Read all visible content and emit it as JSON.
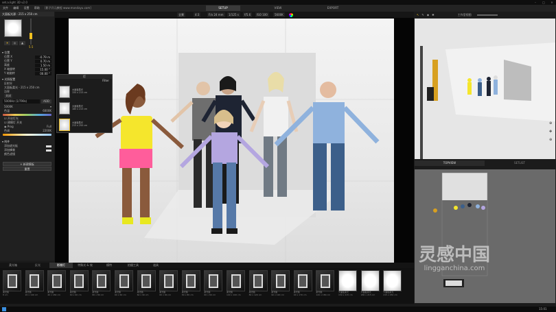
{
  "titlebar": {
    "title": "set.a.light 3D v2.0"
  },
  "menubar": {
    "items": [
      "文件",
      "编辑",
      "设置",
      "帮助"
    ],
    "website": "[影子开元教程 www.mondayu.com]"
  },
  "mode_tabs": [
    {
      "label": "SETUP"
    },
    {
      "label": "VIEW"
    },
    {
      "label": "EXPORT"
    }
  ],
  "left": {
    "header": "大面板光源 - 215 x 250 cm",
    "power_value": "5.5",
    "position_section": "位置",
    "fields": [
      {
        "label": "位置 X",
        "value": "-0.79 m"
      },
      {
        "label": "位置 Y",
        "value": "0.70 m"
      },
      {
        "label": "高度",
        "value": "1.50 m"
      },
      {
        "label": "X 轴旋转",
        "value": "15.00 °"
      },
      {
        "label": "Y 轴旋转",
        "value": "00.00 °"
      }
    ],
    "light_section": "光照配置",
    "modifier_label": "反射伞",
    "modifier_value": "大面板柔光 - 215 x 250 cm",
    "power_label": "功率",
    "mode_label": "关闭",
    "kelvin_value": "5000Hz (1/799s)",
    "add_label": "ADD",
    "kelvin_select": "5000K",
    "kelvin_left": "色温",
    "kelvin_right": "6000K",
    "check_a": "开启灯光",
    "check_b": "建模灯 开关",
    "opt_a": "Prog",
    "opt_b": "Full",
    "hue_left": "色调",
    "hue_right": "2200K",
    "effect_section": "附件",
    "effect_a": "添加遮光板",
    "effect_b": "添加蜂巢",
    "effect_c": "颜色滤镜",
    "apply_button": "+ 新建模板",
    "reset_button": "重置"
  },
  "viewport": {
    "toolbar": [
      "全景",
      "4:3",
      "F/o 24 mm",
      "1/125 s",
      "f/5.6",
      "ISO 100",
      "5600K"
    ],
    "popup": {
      "title": "灯",
      "filter": "Filter",
      "items": [
        {
          "name": "大面板柔光",
          "size": "150 x 215 cm"
        },
        {
          "name": "大面板柔光",
          "size": "180 x 215 cm"
        },
        {
          "name": "大面板柔光",
          "size": "215 x 250 cm"
        }
      ]
    }
  },
  "right": {
    "label": "工作室视图",
    "topview_tab": "TOPVIEW",
    "setlist_tab": "SETLIST"
  },
  "bottom_tabs": [
    "柔光箱",
    "反光",
    "影棚灯",
    "特殊光 & 效",
    "模特",
    "拍摄工具",
    "道具"
  ],
  "library": [
    {
      "name": "柔光箱",
      "size": "8 cm"
    },
    {
      "name": "柔光箱",
      "size": "20 x 140 cm"
    },
    {
      "name": "柔光箱",
      "size": "40 x 180 cm"
    },
    {
      "name": "柔光箱",
      "size": "60 x 90 cm"
    },
    {
      "name": "柔光箱",
      "size": "80 x 80 cm"
    },
    {
      "name": "柔光箱",
      "size": "60 x 60 cm"
    },
    {
      "name": "柔光箱",
      "size": "60 x 90 cm"
    },
    {
      "name": "柔光箱",
      "size": "60 x 90 cm"
    },
    {
      "name": "柔光箱",
      "size": "80 x 80 cm"
    },
    {
      "name": "柔光箱",
      "size": "60 x 60 cm"
    },
    {
      "name": "柔光箱",
      "size": "100 x 100 cm"
    },
    {
      "name": "柔光箱",
      "size": "80 x 120 cm"
    },
    {
      "name": "柔光箱",
      "size": "90 x 120 cm"
    },
    {
      "name": "柔光箱",
      "size": "90 x 170 cm"
    },
    {
      "name": "柔光箱",
      "size": "120 x 180 cm"
    },
    {
      "name": "大面板柔光",
      "size": "150 x 215 cm"
    },
    {
      "name": "大面板柔光",
      "size": "180 x 215 cm"
    },
    {
      "name": "大面板柔光",
      "size": "215 x 250 cm"
    }
  ],
  "watermark": {
    "cn": "灵感中国",
    "en": "lingganchina.com"
  },
  "taskbar": {
    "time": "15:01"
  },
  "colors": {
    "accent": "#f0c020",
    "panel": "#202020"
  }
}
